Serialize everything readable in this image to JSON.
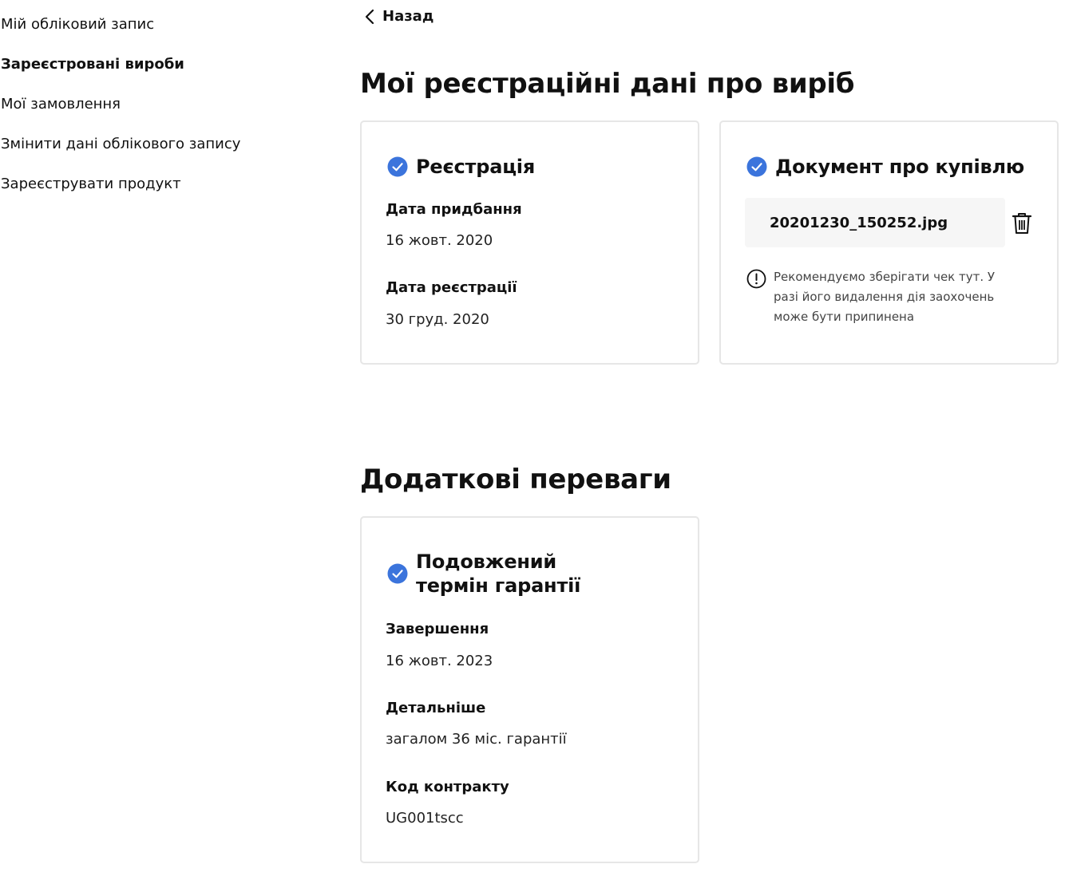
{
  "sidebar": {
    "items": [
      {
        "label": "Мій обліковий запис",
        "active": false
      },
      {
        "label": "Зареєстровані вироби",
        "active": true
      },
      {
        "label": "Мої замовлення",
        "active": false
      },
      {
        "label": "Змінити дані облікового запису",
        "active": false
      },
      {
        "label": "Зареєструвати продукт",
        "active": false
      }
    ]
  },
  "header": {
    "back_label": "Назад",
    "title": "Мої реєстраційні дані про виріб"
  },
  "registration_card": {
    "title": "Реєстрація",
    "purchase_date_label": "Дата придбання",
    "purchase_date": "16 жовт. 2020",
    "registration_date_label": "Дата реєстрації",
    "registration_date": "30 груд. 2020"
  },
  "purchase_document_card": {
    "title": "Документ про купівлю",
    "file_name": "20201230_150252.jpg",
    "note": "Рекомендуємо зберігати чек тут. У разі його видалення дія заохочень може бути припинена"
  },
  "benefits": {
    "title": "Додаткові переваги",
    "warranty_card": {
      "title": "Подовжений термін гарантії",
      "end_label": "Завершення",
      "end_date": "16 жовт. 2023",
      "details_label": "Детальніше",
      "details": "загалом 36 міс. гарантії",
      "contract_label": "Код контракту",
      "contract_code": "UG001tscc"
    }
  },
  "colors": {
    "check_blue": "#3b74dc",
    "border": "#e6e6e6",
    "file_bg": "#f6f6f6"
  },
  "icons": {
    "back": "chevron-left-icon",
    "check": "check-circle-icon",
    "delete": "trash-icon",
    "info": "exclamation-circle-icon"
  }
}
